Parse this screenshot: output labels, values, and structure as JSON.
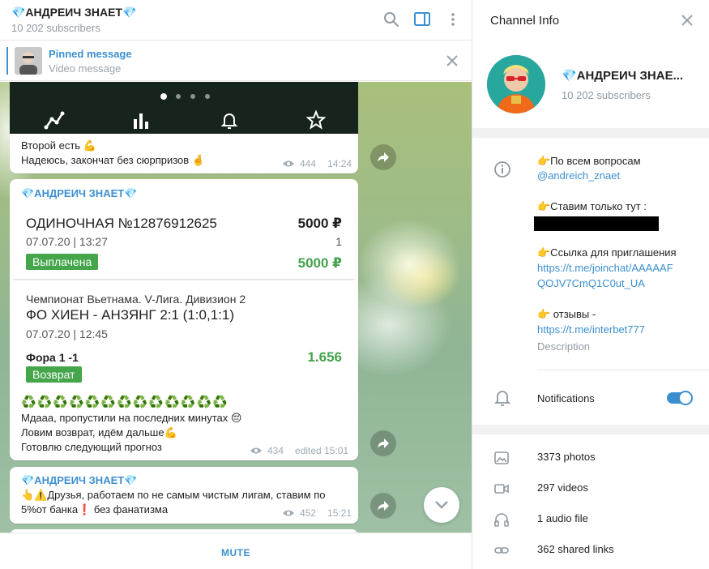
{
  "chat": {
    "title": "💎АНДРЕИЧ ЗНАЕТ💎",
    "subscribers": "10 202 subscribers",
    "pinned": {
      "title": "Pinned message",
      "subtitle": "Video message"
    },
    "mute_label": "MUTE"
  },
  "messages": [
    {
      "lines": [
        "Второй есть 💪",
        "Надеюсь, закончат без сюрпризов 🤞"
      ],
      "views": "444",
      "time": "14:24"
    },
    {
      "author": "💎АНДРЕИЧ ЗНАЕТ💎",
      "bet": {
        "title": "ОДИНОЧНАЯ №12876912625",
        "amount": "5000 ₽",
        "date1": "07.07.20 | 13:27",
        "count": "1",
        "status": "Выплачена",
        "payout": "5000 ₽",
        "league": "Чемпионат Вьетнама. V-Лига. Дивизион 2",
        "match": "ФО ХИЕН - АНЗЯНГ 2:1 (1:0,1:1)",
        "date2": "07.07.20 | 12:45",
        "market": "Фора 1 -1",
        "odds": "1.656",
        "result": "Возврат"
      },
      "emoji_row": "♻️♻️♻️♻️♻️♻️♻️♻️♻️♻️♻️♻️♻️",
      "lines": [
        "Мдааа, пропустили на последних минутах 😔",
        "Ловим возврат, идём дальше💪",
        "Готовлю следующий прогноз"
      ],
      "views": "434",
      "time": "edited 15:01"
    },
    {
      "author": "💎АНДРЕИЧ ЗНАЕТ💎",
      "lines": [
        "👆⚠️Друзья, работаем по не самым чистым лигам, ставим по",
        "5%от банка❗ без фанатизма"
      ],
      "views": "452",
      "time": "15:21"
    }
  ],
  "info": {
    "header": "Channel Info",
    "name": "💎АНДРЕИЧ ЗНАЕ...",
    "subscribers": "10 202 subscribers",
    "description": {
      "l1": "👉По всем вопросам",
      "l2": "@andreich_znaet",
      "l3": "👉Ставим только тут :",
      "l4": "👉Ссылка для приглашения",
      "l5": "https://t.me/joinchat/AAAAAF",
      "l6": "QOJV7CmQ1C0ut_UA",
      "l7": "👉 отзывы -",
      "l8": "https://t.me/interbet777",
      "caption": "Description"
    },
    "notifications_label": "Notifications",
    "notifications_on": true,
    "media": {
      "photos": "3373 photos",
      "videos": "297 videos",
      "audio": "1 audio file",
      "links": "362 shared links"
    }
  },
  "colors": {
    "accent": "#3b8fd0",
    "green": "#45a24b"
  }
}
